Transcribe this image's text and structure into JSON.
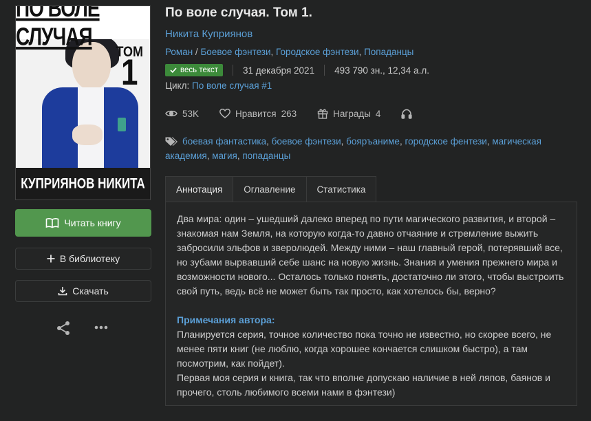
{
  "cover": {
    "title_text": "ПО ВОЛЕ СЛУЧАЯ",
    "tom_label": "ТОМ",
    "tom_number": "1",
    "author_text": "КУПРИЯНОВ НИКИТА"
  },
  "actions": {
    "read_label": "Читать книгу",
    "library_label": "В библиотеку",
    "download_label": "Скачать"
  },
  "book": {
    "title": "По воле случая. Том 1.",
    "author": "Никита Куприянов",
    "genres": [
      "Роман",
      "Боевое фэнтези",
      "Городское фэнтези",
      "Попаданцы"
    ],
    "status": "весь текст",
    "date": "31 декабря 2021",
    "size": "493 790 зн., 12,34 а.л.",
    "cycle_label": "Цикл:",
    "cycle_link": "По воле случая #1"
  },
  "stats": {
    "views": "53K",
    "likes_label": "Нравится",
    "likes": "263",
    "awards_label": "Награды",
    "awards": "4"
  },
  "tags": [
    "боевая фантастика",
    "боевое фэнтези",
    "бояръаниме",
    "городское фентези",
    "магическая академия",
    "магия",
    "попаданцы"
  ],
  "tabs": [
    {
      "label": "Аннотация",
      "active": true
    },
    {
      "label": "Оглавление",
      "active": false
    },
    {
      "label": "Статистика",
      "active": false
    }
  ],
  "annotation": {
    "text": "Два мира: один – ушедший далеко вперед по пути магического развития, и второй – знакомая нам Земля, на которую когда-то давно отчаяние и стремление выжить забросили эльфов и зверолюдей. Между ними – наш главный герой, потерявший все, но зубами вырвавший себе шанс на новую жизнь. Знания и умения прежнего мира и возможности нового... Осталось только понять, достаточно ли этого, чтобы выстроить свой путь, ведь всё не может быть так просто, как хотелось бы, верно?",
    "notes_title": "Примечания автора:",
    "notes_1": "Планируется серия, точное количество пока точно не известно, но скорее всего, не менее пяти книг (не люблю, когда хорошее кончается слишком быстро), а там посмотрим, как пойдет).",
    "notes_2": "Первая моя серия и книга, так что вполне допускаю наличие в ней ляпов, баянов и прочего, столь любимого всеми нами в фэнтези)"
  },
  "colors": {
    "background": "#222323",
    "accent_green": "#52974e",
    "link_blue": "#5b9fd6"
  }
}
